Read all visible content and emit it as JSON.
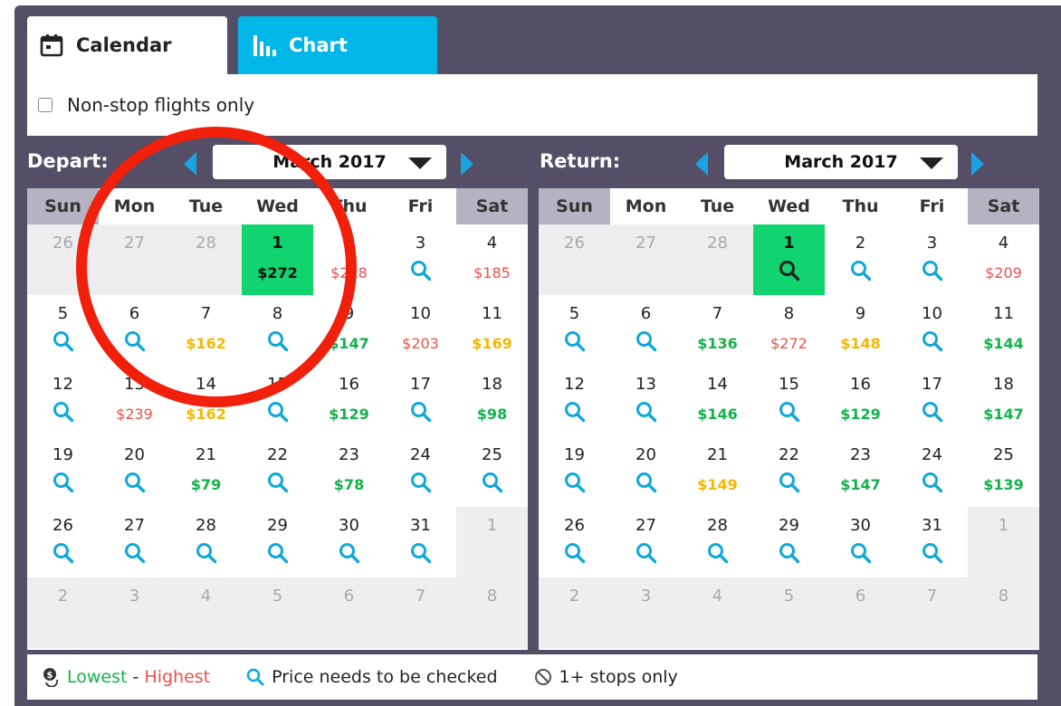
{
  "tabs": {
    "calendar": "Calendar",
    "chart": "Chart"
  },
  "filter": {
    "nonstop_label": "Non-stop flights only"
  },
  "depart": {
    "label": "Depart:",
    "month": "March 2017"
  },
  "return": {
    "label": "Return:",
    "month": "March 2017"
  },
  "weekdays": [
    "Sun",
    "Mon",
    "Tue",
    "Wed",
    "Thu",
    "Fri",
    "Sat"
  ],
  "depart_cells": [
    {
      "d": "26",
      "grey": true
    },
    {
      "d": "27",
      "grey": true
    },
    {
      "d": "28",
      "grey": true
    },
    {
      "d": "1",
      "sel": true,
      "p": "$272"
    },
    {
      "d": "2",
      "p": "$218",
      "c": "red"
    },
    {
      "d": "3",
      "q": true
    },
    {
      "d": "4",
      "p": "$185",
      "c": "red"
    },
    {
      "d": "5",
      "q": true
    },
    {
      "d": "6",
      "q": true
    },
    {
      "d": "7",
      "p": "$162",
      "c": "yellow"
    },
    {
      "d": "8",
      "q": true
    },
    {
      "d": "9",
      "p": "$147",
      "c": "green"
    },
    {
      "d": "10",
      "p": "$203",
      "c": "red"
    },
    {
      "d": "11",
      "p": "$169",
      "c": "yellow"
    },
    {
      "d": "12",
      "q": true
    },
    {
      "d": "13",
      "p": "$239",
      "c": "red"
    },
    {
      "d": "14",
      "p": "$162",
      "c": "yellow"
    },
    {
      "d": "15",
      "q": true
    },
    {
      "d": "16",
      "p": "$129",
      "c": "green"
    },
    {
      "d": "17",
      "q": true
    },
    {
      "d": "18",
      "p": "$98",
      "c": "green"
    },
    {
      "d": "19",
      "q": true
    },
    {
      "d": "20",
      "q": true
    },
    {
      "d": "21",
      "p": "$79",
      "c": "green"
    },
    {
      "d": "22",
      "q": true
    },
    {
      "d": "23",
      "p": "$78",
      "c": "green"
    },
    {
      "d": "24",
      "q": true
    },
    {
      "d": "25",
      "q": true
    },
    {
      "d": "26",
      "q": true
    },
    {
      "d": "27",
      "q": true
    },
    {
      "d": "28",
      "q": true
    },
    {
      "d": "29",
      "q": true
    },
    {
      "d": "30",
      "q": true
    },
    {
      "d": "31",
      "q": true
    },
    {
      "d": "1",
      "grey": true
    },
    {
      "d": "2",
      "grey": true
    },
    {
      "d": "3",
      "grey": true
    },
    {
      "d": "4",
      "grey": true
    },
    {
      "d": "5",
      "grey": true
    },
    {
      "d": "6",
      "grey": true
    },
    {
      "d": "7",
      "grey": true
    },
    {
      "d": "8",
      "grey": true
    }
  ],
  "return_cells": [
    {
      "d": "26",
      "grey": true
    },
    {
      "d": "27",
      "grey": true
    },
    {
      "d": "28",
      "grey": true
    },
    {
      "d": "1",
      "sel": true,
      "q": true
    },
    {
      "d": "2",
      "q": true
    },
    {
      "d": "3",
      "q": true
    },
    {
      "d": "4",
      "p": "$209",
      "c": "red"
    },
    {
      "d": "5",
      "q": true
    },
    {
      "d": "6",
      "q": true
    },
    {
      "d": "7",
      "p": "$136",
      "c": "green"
    },
    {
      "d": "8",
      "p": "$272",
      "c": "red"
    },
    {
      "d": "9",
      "p": "$148",
      "c": "yellow"
    },
    {
      "d": "10",
      "q": true
    },
    {
      "d": "11",
      "p": "$144",
      "c": "green"
    },
    {
      "d": "12",
      "q": true
    },
    {
      "d": "13",
      "q": true
    },
    {
      "d": "14",
      "p": "$146",
      "c": "green"
    },
    {
      "d": "15",
      "q": true
    },
    {
      "d": "16",
      "p": "$129",
      "c": "green"
    },
    {
      "d": "17",
      "q": true
    },
    {
      "d": "18",
      "p": "$147",
      "c": "green"
    },
    {
      "d": "19",
      "q": true
    },
    {
      "d": "20",
      "q": true
    },
    {
      "d": "21",
      "p": "$149",
      "c": "yellow"
    },
    {
      "d": "22",
      "q": true
    },
    {
      "d": "23",
      "p": "$147",
      "c": "green"
    },
    {
      "d": "24",
      "q": true
    },
    {
      "d": "25",
      "p": "$139",
      "c": "green"
    },
    {
      "d": "26",
      "q": true
    },
    {
      "d": "27",
      "q": true
    },
    {
      "d": "28",
      "q": true
    },
    {
      "d": "29",
      "q": true
    },
    {
      "d": "30",
      "q": true
    },
    {
      "d": "31",
      "q": true
    },
    {
      "d": "1",
      "grey": true
    },
    {
      "d": "2",
      "grey": true
    },
    {
      "d": "3",
      "grey": true
    },
    {
      "d": "4",
      "grey": true
    },
    {
      "d": "5",
      "grey": true
    },
    {
      "d": "6",
      "grey": true
    },
    {
      "d": "7",
      "grey": true
    },
    {
      "d": "8",
      "grey": true
    }
  ],
  "legend": {
    "lowest": "Lowest",
    "dash": " - ",
    "highest": "Highest",
    "check": "Price needs to be checked",
    "stops": "1+ stops only"
  },
  "colors": {
    "panel": "#544e66",
    "accent": "#00b7e8",
    "arrow": "#1aa3e3",
    "selected": "#11d46e",
    "green": "#13b24a",
    "yellow": "#f5b800",
    "red": "#e8534a",
    "magnifier": "#10a8d8",
    "annotation": "#f0200d"
  },
  "icons": {
    "calendar_tab": "calendar-icon",
    "chart_tab": "bar-chart-icon",
    "price_check": "magnifier-icon",
    "legend_price": "money-icon",
    "legend_stops": "no-entry-icon"
  }
}
